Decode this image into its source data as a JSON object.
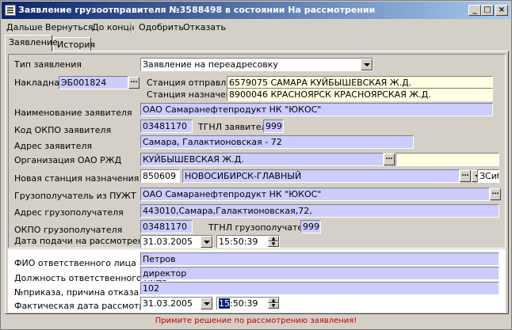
{
  "window": {
    "title": "Заявление грузоотправителя №3588498 в состоянии На рассмотрении"
  },
  "menu": [
    "Дальше",
    "Вернуться",
    "До конца",
    "Одобрить",
    "Отказать"
  ],
  "tabs": [
    "Заявление",
    "История"
  ],
  "form": {
    "request_type": {
      "label": "Тип заявления",
      "value": "Заявление на переадресовку"
    },
    "waybill": {
      "label": "Накладная",
      "value": "ЭБ001824"
    },
    "departure": {
      "label": "Станция отправления",
      "value": "6579075   САМАРА   КУЙБЫШЕВСКАЯ Ж.Д."
    },
    "destination": {
      "label": "Станция назначения",
      "value": "8900046   КРАСНОЯРСК    КРАСНОЯРСКАЯ Ж.Д."
    },
    "applicant_name": {
      "label": "Наименование заявителя",
      "value": "ОАО Самаранефтепродукт НК \"ЮКОС\""
    },
    "okpo_applicant": {
      "label": "Код ОКПО заявителя",
      "value": "03481170"
    },
    "tgnl_applicant": {
      "label": "ТГНЛ заявителя",
      "value": "9999"
    },
    "applicant_address": {
      "label": "Адрес заявителя",
      "value": "Самара, Галактионовская - 72"
    },
    "rzd_org": {
      "label": "Организация ОАО РЖД",
      "value": "КУЙБЫШЕВСКАЯ Ж.Д."
    },
    "new_station": {
      "label": "Новая станция назначения",
      "code": "850609",
      "name": "НОВОСИБИРСК-ГЛАВНЫЙ",
      "road": "ЗСиб"
    },
    "consignee": {
      "label": "Грузополучатель из ПУЖТ",
      "value": "ОАО Самаранефтепродукт НК \"ЮКОС\""
    },
    "consignee_address": {
      "label": "Адрес грузополучателя",
      "value": "443010,Самара,Галактионовская,72,"
    },
    "okpo_consignee": {
      "label": "ОКПО грузополучателя",
      "value": "03481170"
    },
    "tgnl_consignee": {
      "label": "ТГНЛ грузополучателя",
      "value": "9999"
    },
    "submit_date": {
      "label": "Дата подачи на рассмотрение",
      "date": "31.03.2005",
      "time": "15:50:39"
    },
    "responsible": {
      "label": "ФИО ответственного лица",
      "value": "Петров"
    },
    "position": {
      "label": "Должность ответственного лица",
      "value": "директор"
    },
    "order": {
      "label": "№приказа, причина отказа",
      "value": "102"
    },
    "actual_date": {
      "label": "Фактическая дата рассмотрения",
      "date": "31.03.2005",
      "time_sel": "15",
      "time_rest": ":50:39"
    }
  },
  "status": "Примите решение по рассмотрению заявления!",
  "colors": {
    "field_blue": "#ccccff",
    "field_yellow": "#ffffe1",
    "title_start": "#0a246a",
    "status_red": "#c00000"
  }
}
